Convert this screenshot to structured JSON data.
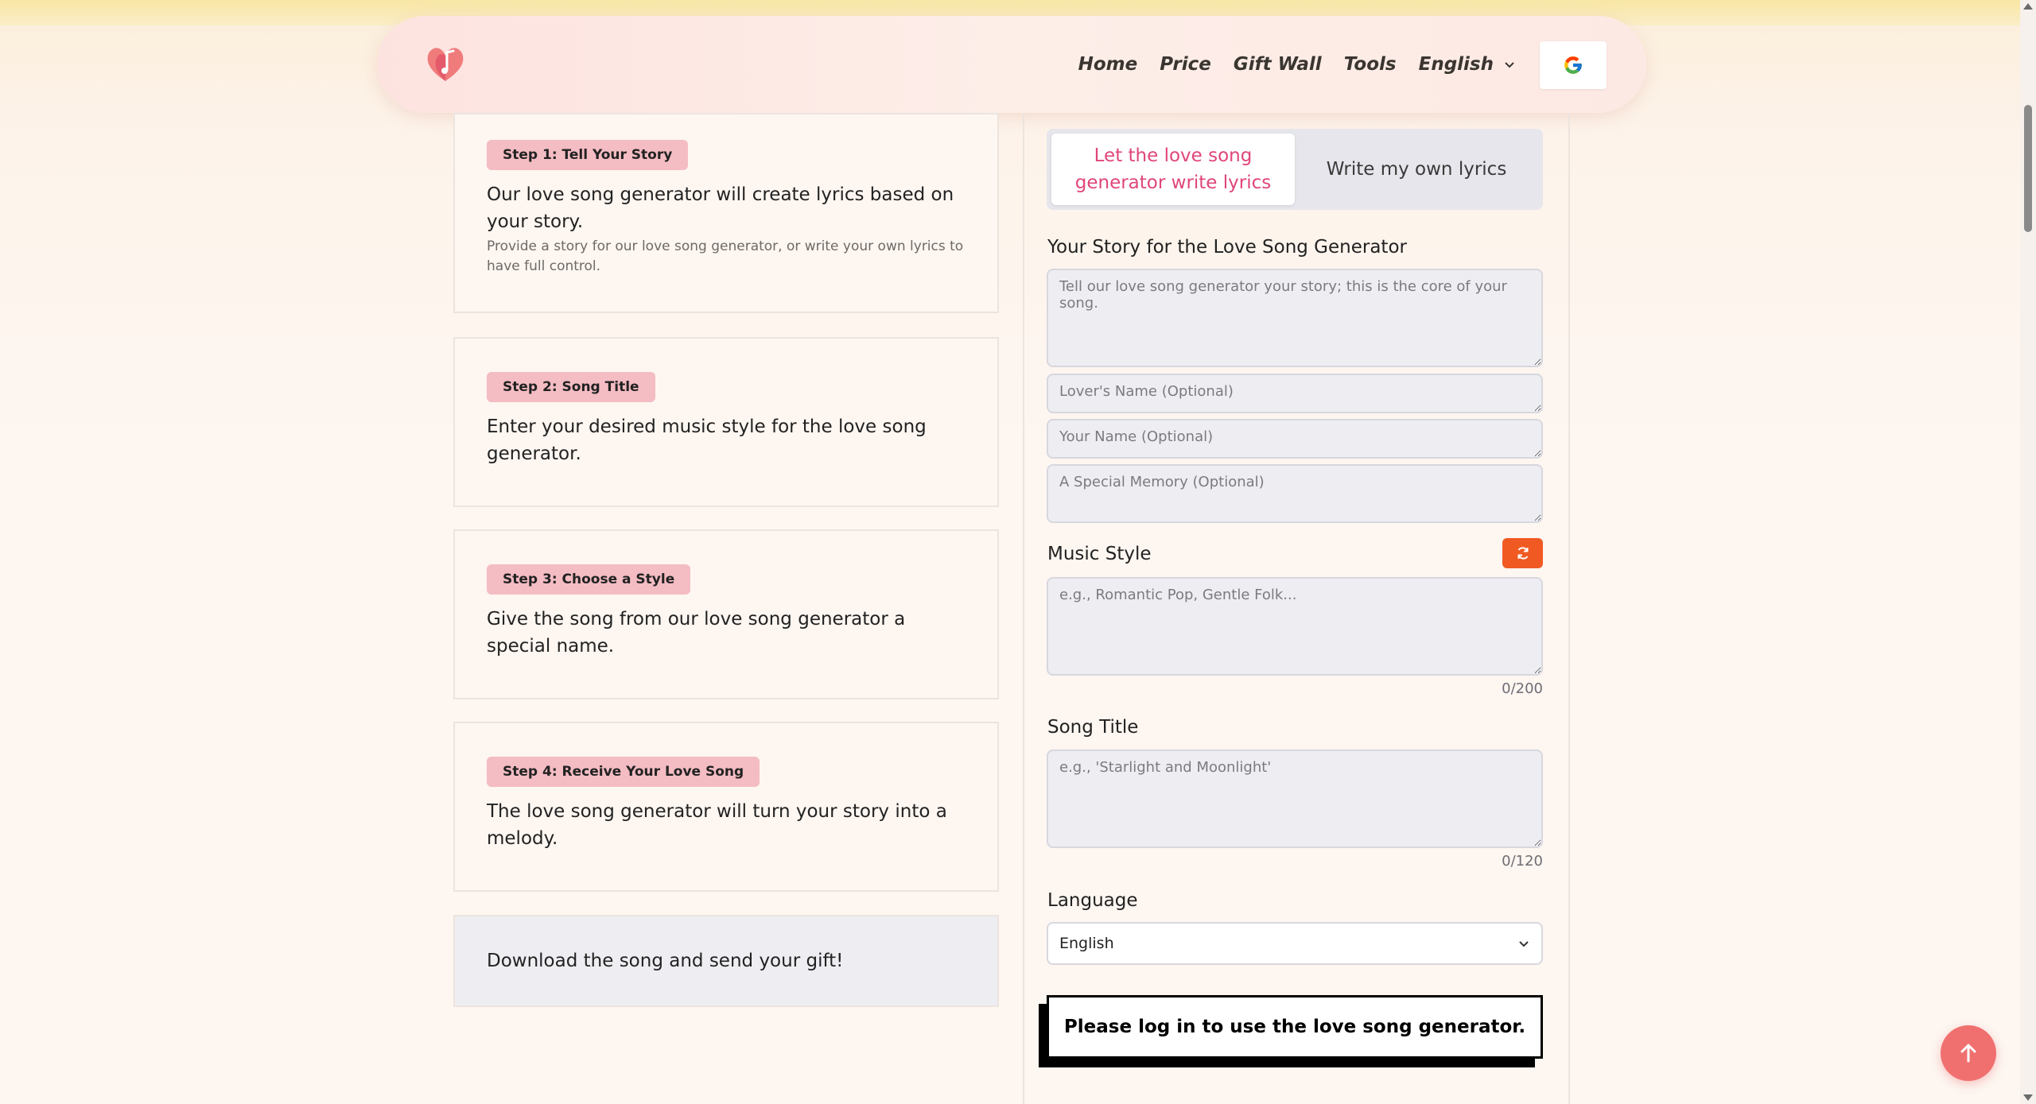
{
  "nav": {
    "items": [
      "Home",
      "Price",
      "Gift Wall",
      "Tools"
    ],
    "language": "English"
  },
  "steps": [
    {
      "badge": "Step 1: Tell Your Story",
      "text": "Our love song generator will create lyrics based on your story.",
      "sub": "Provide a story for our love song generator, or write your own lyrics to have full control."
    },
    {
      "badge": "Step 2: Song Title",
      "text": "Enter your desired music style for the love song generator."
    },
    {
      "badge": "Step 3: Choose a Style",
      "text": "Give the song from our love song generator a special name."
    },
    {
      "badge": "Step 4: Receive Your Love Song",
      "text": "The love song generator will turn your story into a melody."
    }
  ],
  "final_step": "Download the song and send your gift!",
  "tabs": {
    "active": "Let the love song generator write lyrics",
    "inactive": "Write my own lyrics"
  },
  "story": {
    "label": "Your Story for the Love Song Generator",
    "placeholder": "Tell our love song generator your story; this is the core of your song."
  },
  "lover_name": {
    "placeholder": "Lover's Name (Optional)"
  },
  "your_name": {
    "placeholder": "Your Name (Optional)"
  },
  "memory": {
    "placeholder": "A Special Memory (Optional)"
  },
  "music_style": {
    "label": "Music Style",
    "placeholder": "e.g., Romantic Pop, Gentle Folk...",
    "counter": "0/200"
  },
  "song_title": {
    "label": "Song Title",
    "placeholder": "e.g., 'Starlight and Moonlight'",
    "counter": "0/120"
  },
  "language": {
    "label": "Language",
    "selected": "English"
  },
  "login_button": "Please log in to use the love song generator.",
  "colors": {
    "accent_pink": "#e0457b",
    "badge_pink": "#f4bcc3",
    "refresh_orange": "#f05a22",
    "to_top": "#f07070"
  }
}
